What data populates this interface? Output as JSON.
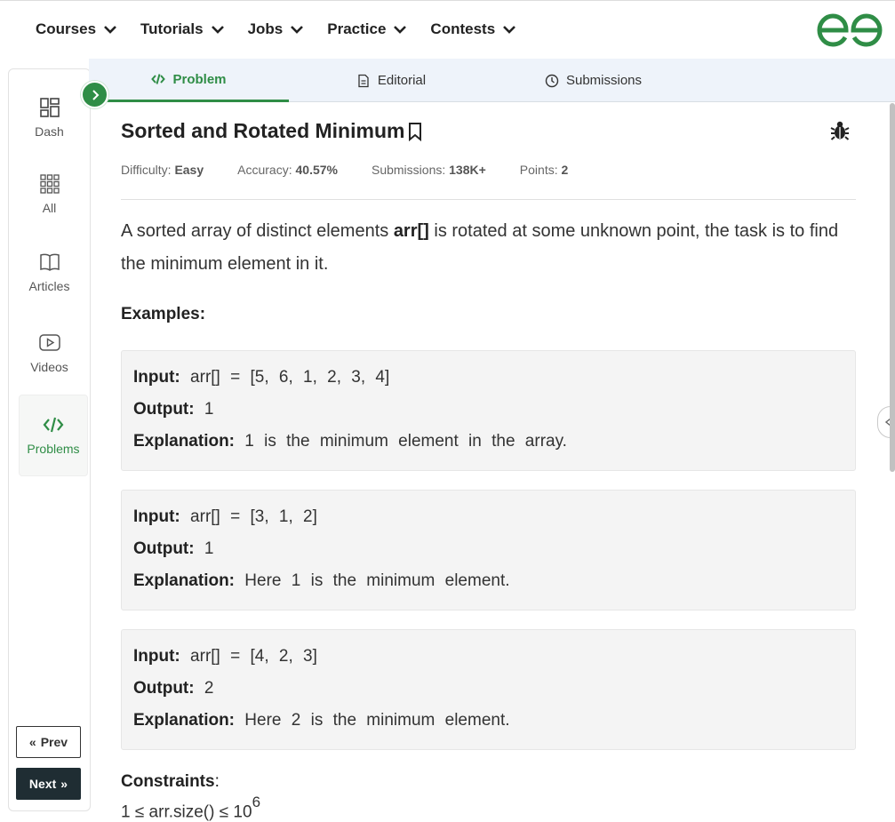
{
  "topnav": {
    "items": [
      "Courses",
      "Tutorials",
      "Jobs",
      "Practice",
      "Contests"
    ],
    "logo_text": "GfG"
  },
  "sidebar": {
    "items": [
      {
        "label": "Dash",
        "icon": "dashboard-icon"
      },
      {
        "label": "All",
        "icon": "grid-icon"
      },
      {
        "label": "Articles",
        "icon": "book-icon"
      },
      {
        "label": "Videos",
        "icon": "video-icon"
      },
      {
        "label": "Problems",
        "icon": "code-icon",
        "active": true
      }
    ],
    "prev_label": "Prev",
    "next_label": "Next"
  },
  "tabs": [
    {
      "label": "Problem",
      "icon": "code-icon",
      "active": true
    },
    {
      "label": "Editorial",
      "icon": "document-icon"
    },
    {
      "label": "Submissions",
      "icon": "clock-icon"
    }
  ],
  "problem": {
    "title": "Sorted and Rotated Minimum",
    "difficulty_label": "Difficulty:",
    "difficulty": "Easy",
    "accuracy_label": "Accuracy:",
    "accuracy": "40.57%",
    "submissions_label": "Submissions:",
    "submissions": "138K+",
    "points_label": "Points:",
    "points": "2",
    "desc_pre": "A sorted array of distinct elements ",
    "desc_bold": "arr[]",
    "desc_post": " is rotated at some unknown point, the task is to find the minimum element in it.",
    "examples_heading": "Examples:",
    "examples": [
      {
        "input": "arr[] = [5, 6, 1, 2, 3, 4]",
        "output": "1",
        "explanation": "1 is the minimum element in the array."
      },
      {
        "input": "arr[] = [3, 1, 2]",
        "output": "1",
        "explanation": "Here 1 is the minimum element."
      },
      {
        "input": "arr[] = [4, 2, 3]",
        "output": "2",
        "explanation": "Here 2 is the minimum element."
      }
    ],
    "input_label": "Input:",
    "output_label": "Output:",
    "explanation_label": "Explanation:",
    "constraints_heading": "Constraints",
    "constraint_text": "1 ≤ arr.size() ≤ 10",
    "constraint_exp": "6"
  },
  "colors": {
    "brand_green": "#2f8d46",
    "tab_bar_bg": "#eef3fa",
    "example_bg": "#f4f4f4",
    "next_btn_bg": "#1f2d33"
  }
}
